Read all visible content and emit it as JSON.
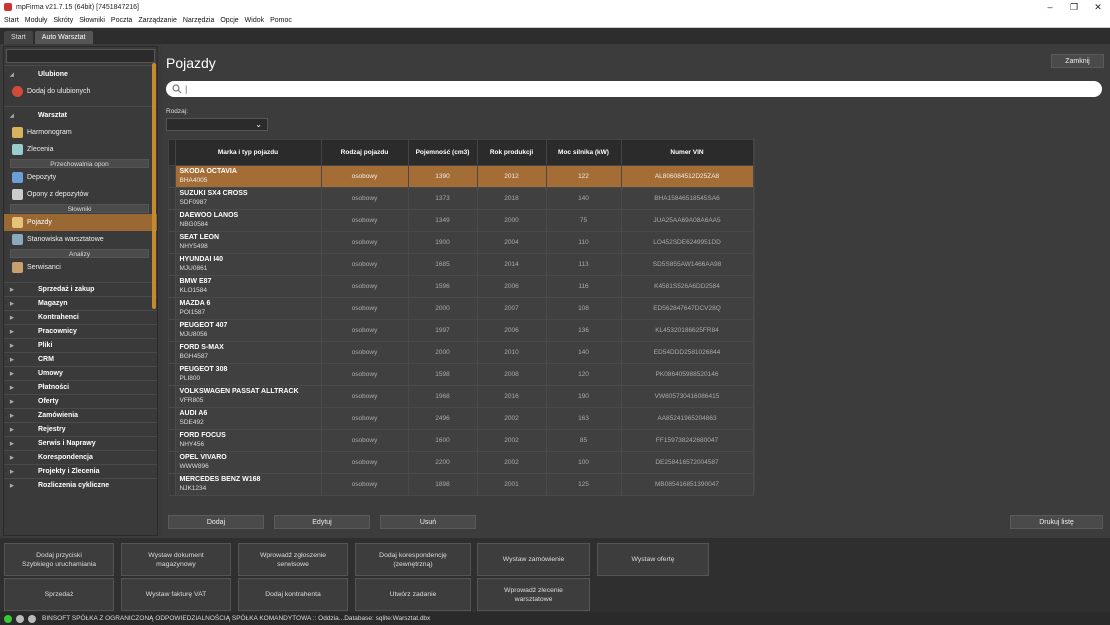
{
  "window": {
    "title": "mpFirma v21.7.15 (64bit) [7451847216]",
    "buttons": [
      "–",
      "❐",
      "✕"
    ]
  },
  "menu": [
    "Start",
    "Moduły",
    "Skróty",
    "Słowniki",
    "Poczta",
    "Zarządzanie",
    "Narzędzia",
    "Opcje",
    "Widok",
    "Pomoc"
  ],
  "tabs": [
    {
      "label": "Start"
    },
    {
      "label": "Auto Warsztat"
    }
  ],
  "sidebar": {
    "favorites_header": "Ulubione",
    "add_favorite": "Dodaj do ulubionych",
    "warsztat_header": "Warsztat",
    "harmonogram": "Harmonogram",
    "zlecenia": "Zlecenia",
    "sub_przechowalnia": "Przechowalnia opon",
    "depozyty": "Depozyty",
    "opony": "Opony z depozytów",
    "sub_slowniki": "Słowniki",
    "pojazdy": "Pojazdy",
    "stanowiska": "Stanowiska warsztatowe",
    "sub_analizy": "Analizy",
    "serwisanci": "Serwisanci",
    "sections": [
      "Sprzedaż i zakup",
      "Magazyn",
      "Kontrahenci",
      "Pracownicy",
      "Pliki",
      "CRM",
      "Umowy",
      "Płatności",
      "Oferty",
      "Zamówienia",
      "Rejestry",
      "Serwis i Naprawy",
      "Korespondencja",
      "Projekty i Zlecenia",
      "Rozliczenia cykliczne"
    ]
  },
  "main": {
    "title": "Pojazdy",
    "close": "Zamknij",
    "search_value": "|",
    "rodzaj_label": "Rodzaj:",
    "rodzaj_value": "",
    "columns": [
      "Marka i typ pojazdu",
      "Rodzaj pojazdu",
      "Pojemność (cm3)",
      "Rok produkcji",
      "Moc silnika (kW)",
      "Numer VIN"
    ],
    "rows": [
      {
        "name": "SKODA OCTAVIA",
        "reg": "BHA4005",
        "type": "osobowy",
        "cap": "1390",
        "year": "2012",
        "power": "122",
        "vin": "AL806084512D25ZA8"
      },
      {
        "name": "SUZUKI SX4 CROSS",
        "reg": "SDF0987",
        "type": "osobowy",
        "cap": "1373",
        "year": "2018",
        "power": "140",
        "vin": "BHA15846518545SA6"
      },
      {
        "name": "DAEWOO LANOS",
        "reg": "NBG0584",
        "type": "osobowy",
        "cap": "1349",
        "year": "2000",
        "power": "75",
        "vin": "JUA25AA69A08A6AA5"
      },
      {
        "name": "SEAT LEON",
        "reg": "NHY5498",
        "type": "osobowy",
        "cap": "1900",
        "year": "2004",
        "power": "110",
        "vin": "LO452SDE6249951DD"
      },
      {
        "name": "HYUNDAI I40",
        "reg": "MJU0861",
        "type": "osobowy",
        "cap": "1685",
        "year": "2014",
        "power": "113",
        "vin": "SD5S855AW1466AA98"
      },
      {
        "name": "BMW E87",
        "reg": "KLO1584",
        "type": "osobowy",
        "cap": "1596",
        "year": "2006",
        "power": "116",
        "vin": "K4581S526A6DD2584"
      },
      {
        "name": "MAZDA 6",
        "reg": "POI1587",
        "type": "osobowy",
        "cap": "2000",
        "year": "2007",
        "power": "108",
        "vin": "ED562847647DCV28Q"
      },
      {
        "name": "PEUGEOT 407",
        "reg": "MJU8056",
        "type": "osobowy",
        "cap": "1997",
        "year": "2006",
        "power": "136",
        "vin": "KL45320186625FR84"
      },
      {
        "name": "FORD S-MAX",
        "reg": "BGH4587",
        "type": "osobowy",
        "cap": "2000",
        "year": "2010",
        "power": "140",
        "vin": "ED54DDD2581026844"
      },
      {
        "name": "PEUGEOT 308",
        "reg": "PLI800",
        "type": "osobowy",
        "cap": "1598",
        "year": "2008",
        "power": "120",
        "vin": "PK086405988520146"
      },
      {
        "name": "VOLKSWAGEN PASSAT ALLTRACK",
        "reg": "VFR805",
        "type": "osobowy",
        "cap": "1968",
        "year": "2016",
        "power": "190",
        "vin": "VW805730416086415"
      },
      {
        "name": "AUDI A6",
        "reg": "SDE492",
        "type": "osobowy",
        "cap": "2496",
        "year": "2002",
        "power": "163",
        "vin": "AA85241965204863"
      },
      {
        "name": "FORD FOCUS",
        "reg": "NHY456",
        "type": "osobowy",
        "cap": "1600",
        "year": "2002",
        "power": "85",
        "vin": "FF159738242680047"
      },
      {
        "name": "OPEL VIVARO",
        "reg": "WWW896",
        "type": "osobowy",
        "cap": "2200",
        "year": "2002",
        "power": "100",
        "vin": "DE258416572004587"
      },
      {
        "name": "MERCEDES BENZ W168",
        "reg": "NJK1234",
        "type": "osobowy",
        "cap": "1898",
        "year": "2001",
        "power": "125",
        "vin": "MB085416851390047"
      }
    ],
    "actions": {
      "add": "Dodaj",
      "edit": "Edytuj",
      "delete": "Usuń",
      "print": "Drukuj listę"
    }
  },
  "quick": [
    "Dodaj przyciski\nSzybkiego uruchamiania",
    "Wystaw dokument\nmagazynowy",
    "Wprowadź zgłoszenie\nserwisowe",
    "Dodaj korespondencję\n(zewnętrzną)",
    "Wystaw zamówienie",
    "Wystaw ofertę",
    "Sprzedaż",
    "Wystaw fakturę VAT",
    "Dodaj kontrahenta",
    "Utwórz zadanie",
    "Wprowadź zlecenie\nwarsztatowe"
  ],
  "status": "BINSOFT SPÓŁKA Z OGRANICZONĄ ODPOWIEDZIALNOŚCIĄ SPÓŁKA KOMANDYTOWA :: Oddzia...Database: sqlite:Warsztat.dbx",
  "colors": {
    "accent": "#a36d35",
    "scroll": "#c68a2e",
    "ok": "#33cc33"
  }
}
